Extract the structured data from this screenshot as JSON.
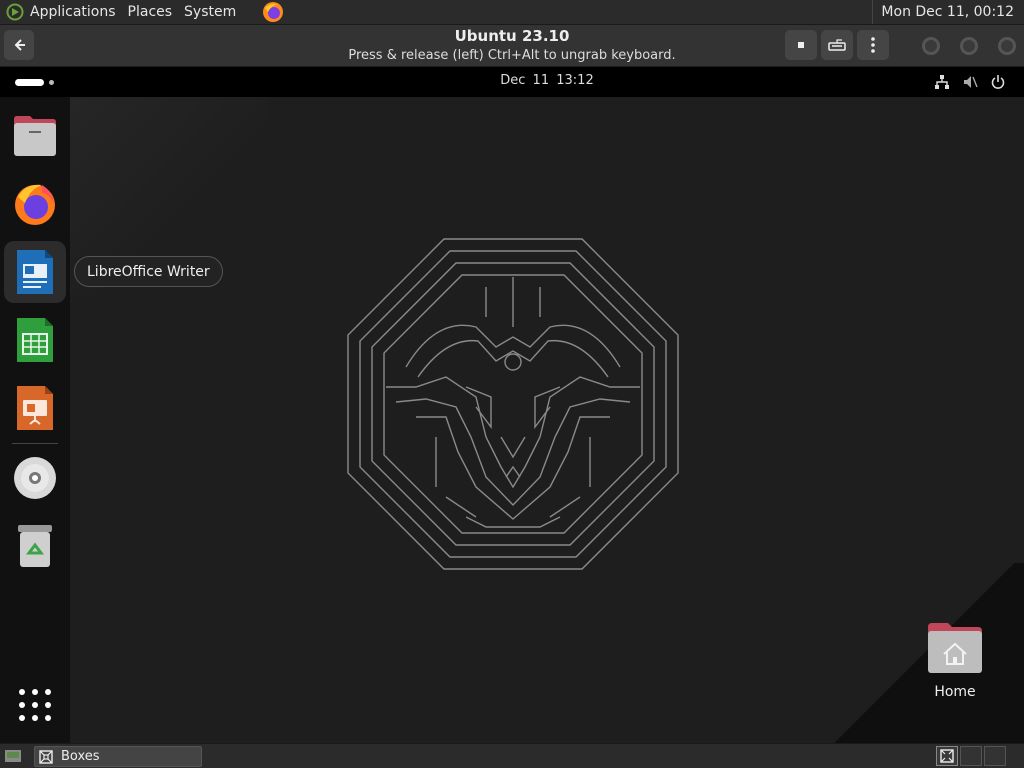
{
  "host_panel": {
    "menus": [
      "Applications",
      "Places",
      "System"
    ],
    "clock": "Mon Dec 11, 00:12"
  },
  "boxes": {
    "title": "Ubuntu 23.10",
    "subtitle": "Press & release (left) Ctrl+Alt to ungrab keyboard."
  },
  "guest": {
    "date": "Dec 11",
    "time": "13:12",
    "tooltip": "LibreOffice Writer",
    "dock_apps": [
      {
        "name": "files",
        "icon": "folder-icon"
      },
      {
        "name": "firefox",
        "icon": "firefox-icon"
      },
      {
        "name": "libreoffice-writer",
        "icon": "writer-icon",
        "active": true
      },
      {
        "name": "libreoffice-calc",
        "icon": "calc-icon"
      },
      {
        "name": "libreoffice-impress",
        "icon": "impress-icon"
      },
      {
        "name": "optical-disc",
        "icon": "disc-icon"
      },
      {
        "name": "trash",
        "icon": "trash-icon"
      }
    ],
    "desktop_icons": [
      {
        "label": "Home",
        "icon": "home-folder-icon"
      }
    ]
  },
  "taskbar": {
    "items": [
      {
        "label": "Boxes"
      }
    ]
  },
  "colors": {
    "desktop_bg": "#1e1e1e",
    "panel_bg": "#2b2b2b",
    "dock_bg": "#111111",
    "folder_top": "#c0465a"
  }
}
